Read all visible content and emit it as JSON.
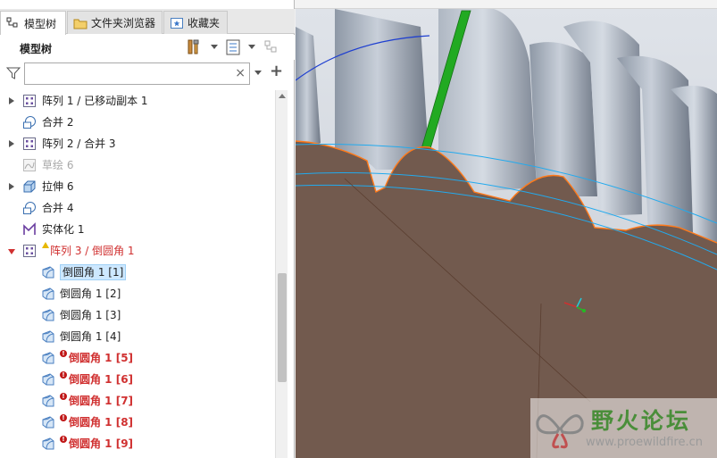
{
  "tabs": [
    {
      "label": "模型树",
      "icon": "model-tree-icon",
      "active": true
    },
    {
      "label": "文件夹浏览器",
      "icon": "folder-browser-icon",
      "active": false
    },
    {
      "label": "收藏夹",
      "icon": "favorites-icon",
      "active": false
    }
  ],
  "tree_header": {
    "title": "模型树",
    "settings_icon": "tools-icon",
    "show_icon": "list-settings-icon",
    "filter_icon": "tree-filter-icon"
  },
  "search": {
    "value": "",
    "placeholder": "",
    "clear_label": "×",
    "add_label": "+"
  },
  "tree": {
    "items": [
      {
        "label": "阵列 1 / 已移动副本 1",
        "icon": "pattern-icon",
        "expand": "closed",
        "style": "normal"
      },
      {
        "label": "合并 2",
        "icon": "merge-icon",
        "expand": "none",
        "style": "normal"
      },
      {
        "label": "阵列 2 / 合并 3",
        "icon": "pattern-icon",
        "expand": "closed",
        "style": "normal"
      },
      {
        "label": "草绘 6",
        "icon": "sketch-icon",
        "expand": "none",
        "style": "dim"
      },
      {
        "label": "拉伸 6",
        "icon": "extrude-icon",
        "expand": "closed",
        "style": "normal"
      },
      {
        "label": "合并 4",
        "icon": "merge-icon",
        "expand": "none",
        "style": "normal"
      },
      {
        "label": "实体化 1",
        "icon": "solidify-icon",
        "expand": "none",
        "style": "normal"
      },
      {
        "label": "阵列 3 / 倒圆角 1",
        "icon": "pattern-icon",
        "expand": "open",
        "style": "red",
        "badge": "warning"
      },
      {
        "label": "倒圆角 1 [1]",
        "icon": "round-icon",
        "style": "selected"
      },
      {
        "label": "倒圆角 1 [2]",
        "icon": "round-icon",
        "style": "normal"
      },
      {
        "label": "倒圆角 1 [3]",
        "icon": "round-icon",
        "style": "normal"
      },
      {
        "label": "倒圆角 1 [4]",
        "icon": "round-icon",
        "style": "normal"
      },
      {
        "label": "倒圆角 1 [5]",
        "icon": "round-icon",
        "style": "error",
        "badge": "error"
      },
      {
        "label": "倒圆角 1 [6]",
        "icon": "round-icon",
        "style": "error",
        "badge": "error"
      },
      {
        "label": "倒圆角 1 [7]",
        "icon": "round-icon",
        "style": "error",
        "badge": "error"
      },
      {
        "label": "倒圆角 1 [8]",
        "icon": "round-icon",
        "style": "error",
        "badge": "error"
      },
      {
        "label": "倒圆角 1 [9]",
        "icon": "round-icon",
        "style": "error",
        "badge": "error"
      }
    ]
  },
  "watermark": {
    "title": "野火论坛",
    "url": "www.proewildfire.cn",
    "logo": "butterfly-logo-icon"
  },
  "colors": {
    "error": "#d03030",
    "selection": "#cde8ff",
    "model_surface": "#725a4e",
    "teeth": "#aab4c2",
    "edge_orange": "#ff7a1a",
    "edge_cyan": "#22aaee",
    "axis_green": "#22aa22"
  }
}
